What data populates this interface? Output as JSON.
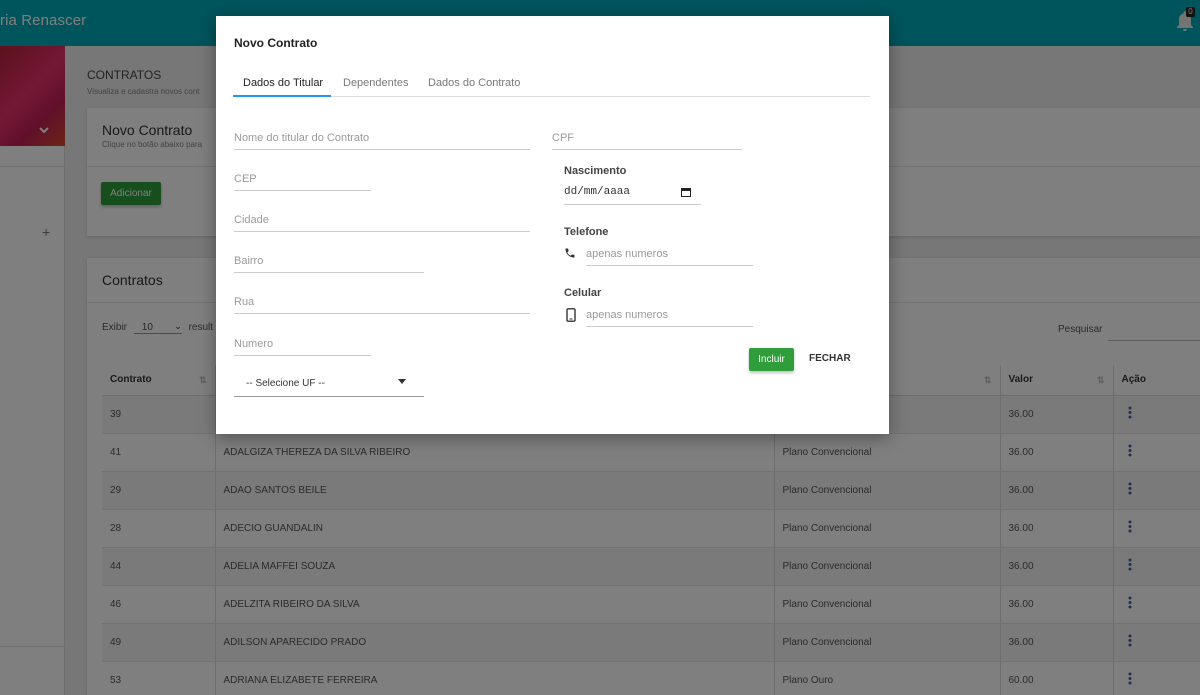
{
  "app": {
    "brand": "ria Renascer",
    "notification_count": "0"
  },
  "page": {
    "title": "CONTRATOS",
    "subtitle": "Visualiza e cadastra novos cont"
  },
  "new_card": {
    "title": "Novo Contrato",
    "subtitle": "Clique no botão abaixo para",
    "add_label": "Adicionar"
  },
  "list_card": {
    "title": "Contratos",
    "show_prefix": "Exibir",
    "show_value": "10",
    "show_suffix": "result",
    "search_label": "Pesquisar",
    "columns": [
      "Contrato",
      "",
      "",
      "Valor",
      "Ação"
    ],
    "rows": [
      {
        "contrato": "39",
        "nome": "",
        "plano": "",
        "valor": "36.00"
      },
      {
        "contrato": "41",
        "nome": "ADALGIZA THEREZA DA SILVA RIBEIRO",
        "plano": "Plano Convencional",
        "valor": "36.00"
      },
      {
        "contrato": "29",
        "nome": "ADAO SANTOS BEILE",
        "plano": "Plano Convencional",
        "valor": "36.00"
      },
      {
        "contrato": "28",
        "nome": "ADECIO GUANDALIN",
        "plano": "Plano Convencional",
        "valor": "36.00"
      },
      {
        "contrato": "44",
        "nome": "ADELIA MAFFEI SOUZA",
        "plano": "Plano Convencional",
        "valor": "36.00"
      },
      {
        "contrato": "46",
        "nome": "ADELZITA RIBEIRO DA SILVA",
        "plano": "Plano Convencional",
        "valor": "36.00"
      },
      {
        "contrato": "49",
        "nome": "ADILSON APARECIDO PRADO",
        "plano": "Plano Convencional",
        "valor": "36.00"
      },
      {
        "contrato": "53",
        "nome": "ADRIANA ELIZABETE FERREIRA",
        "plano": "Plano Ouro",
        "valor": "60.00"
      }
    ]
  },
  "modal": {
    "title": "Novo Contrato",
    "tabs": [
      "Dados do Titular",
      "Dependentes",
      "Dados do Contrato"
    ],
    "fields": {
      "nome_placeholder": "Nome do titular do Contrato",
      "cpf_placeholder": "CPF",
      "cep_placeholder": "CEP",
      "cidade_placeholder": "Cidade",
      "bairro_placeholder": "Bairro",
      "rua_placeholder": "Rua",
      "numero_placeholder": "Numero",
      "uf_selected": "-- Selecione UF --",
      "nascimento_label": "Nascimento",
      "nascimento_value": "dd/mm/aaaa",
      "telefone_label": "Telefone",
      "telefone_placeholder": "apenas numeros",
      "celular_label": "Celular",
      "celular_placeholder": "apenas numeros"
    },
    "incluir_label": "Incluir",
    "fechar_label": "FECHAR"
  },
  "colors": {
    "topbar": "#00a9b8",
    "primary_button": "#2e9d3a",
    "tab_active": "#2196f3"
  }
}
